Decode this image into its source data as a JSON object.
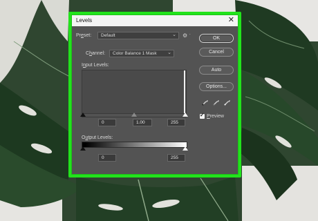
{
  "dialog": {
    "title": "Levels",
    "close_glyph": "✕",
    "preset": {
      "label_prefix": "Pr",
      "label_underlined": "e",
      "label_suffix": "set:",
      "value": "Default"
    },
    "channel": {
      "label_prefix": "C",
      "label_underlined": "h",
      "label_suffix": "annel:",
      "value": "Color Balance 1 Mask"
    },
    "input_levels": {
      "label_prefix": "I",
      "label_underlined": "n",
      "label_suffix": "put Levels:",
      "black": "0",
      "gamma": "1.00",
      "white": "255"
    },
    "output_levels": {
      "label_prefix": "O",
      "label_underlined": "u",
      "label_suffix": "tput Levels:",
      "black": "0",
      "white": "255"
    },
    "buttons": {
      "ok": "OK",
      "cancel": "Cancel",
      "auto": "Auto",
      "options": "Options..."
    },
    "preview": {
      "label_prefix": "",
      "label_underlined": "P",
      "label_suffix": "review",
      "checked": true
    }
  },
  "colors": {
    "highlight_frame": "#22e31c",
    "dialog_bg": "#535353",
    "titlebar_bg": "#f4f4f4"
  },
  "icons": [
    "gear-icon",
    "chevron-down-icon",
    "eyedropper-black-icon",
    "eyedropper-gray-icon",
    "eyedropper-white-icon",
    "close-icon"
  ]
}
